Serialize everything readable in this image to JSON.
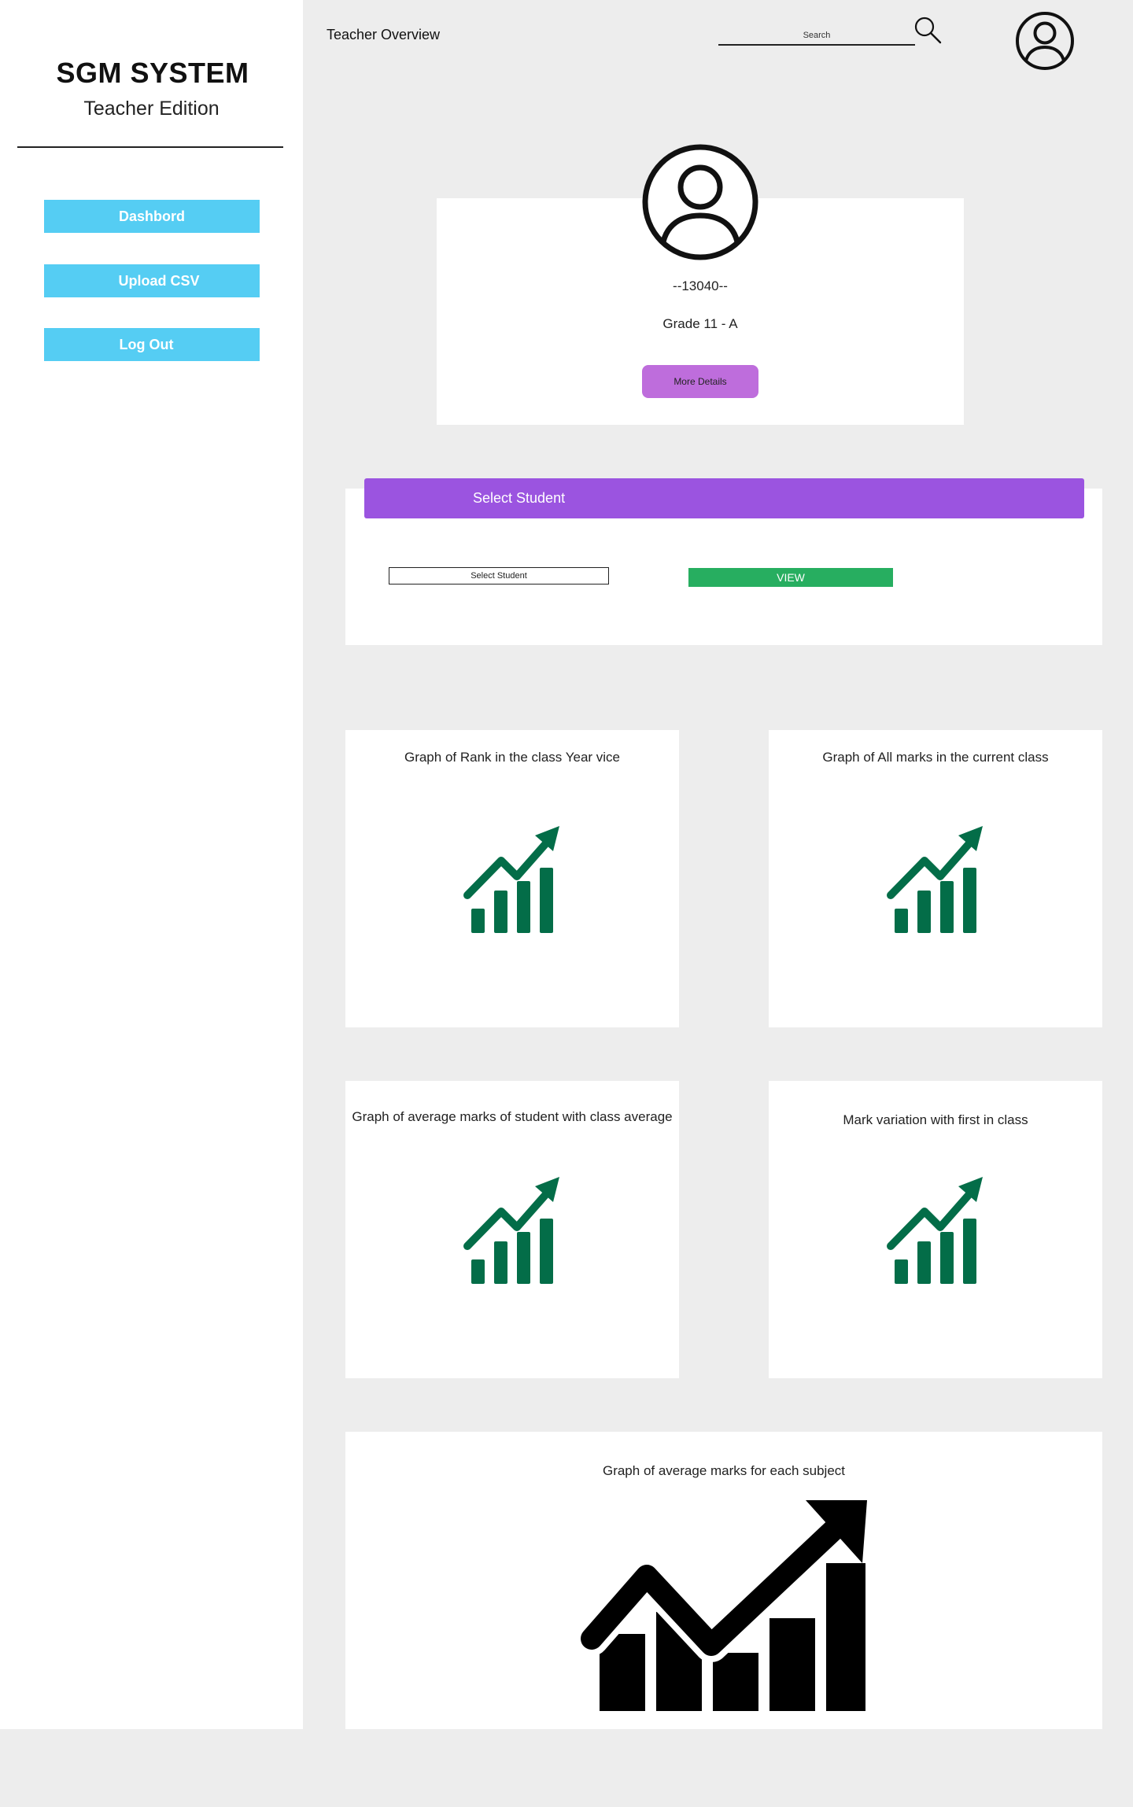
{
  "sidebar": {
    "brand_title": "SGM SYSTEM",
    "brand_subtitle": "Teacher Edition",
    "nav_items": [
      {
        "label": "Dashbord"
      },
      {
        "label": "Upload CSV"
      },
      {
        "label": "Log Out"
      }
    ]
  },
  "topbar": {
    "title": "Teacher Overview",
    "search_placeholder": "Search",
    "search_icon": "search-icon",
    "avatar_icon": "user-circle-icon"
  },
  "profile": {
    "student_id": "--13040--",
    "grade": "Grade 11 - A",
    "more_details_label": "More Details",
    "avatar_icon": "user-circle-icon"
  },
  "student_selector": {
    "header": "Select Student",
    "select_value": "Select Student",
    "view_label": "VIEW"
  },
  "graphs": [
    {
      "title": "Graph of Rank in the class Year vice",
      "icon": "growth-chart-icon"
    },
    {
      "title": "Graph of All marks in the current class",
      "icon": "growth-chart-icon"
    },
    {
      "title": "Graph of average marks of student with class average",
      "icon": "growth-chart-icon"
    },
    {
      "title": "Mark variation with first in class",
      "icon": "growth-chart-icon"
    },
    {
      "title": "Graph of average marks for each subject",
      "icon": "growth-chart-icon"
    }
  ],
  "colors": {
    "nav_button": "#55cdf3",
    "select_header": "#9b54e0",
    "more_details_button": "#be6ddc",
    "view_button": "#27ae60",
    "small_graph_icon": "#036d48",
    "large_graph_icon": "#000000"
  }
}
